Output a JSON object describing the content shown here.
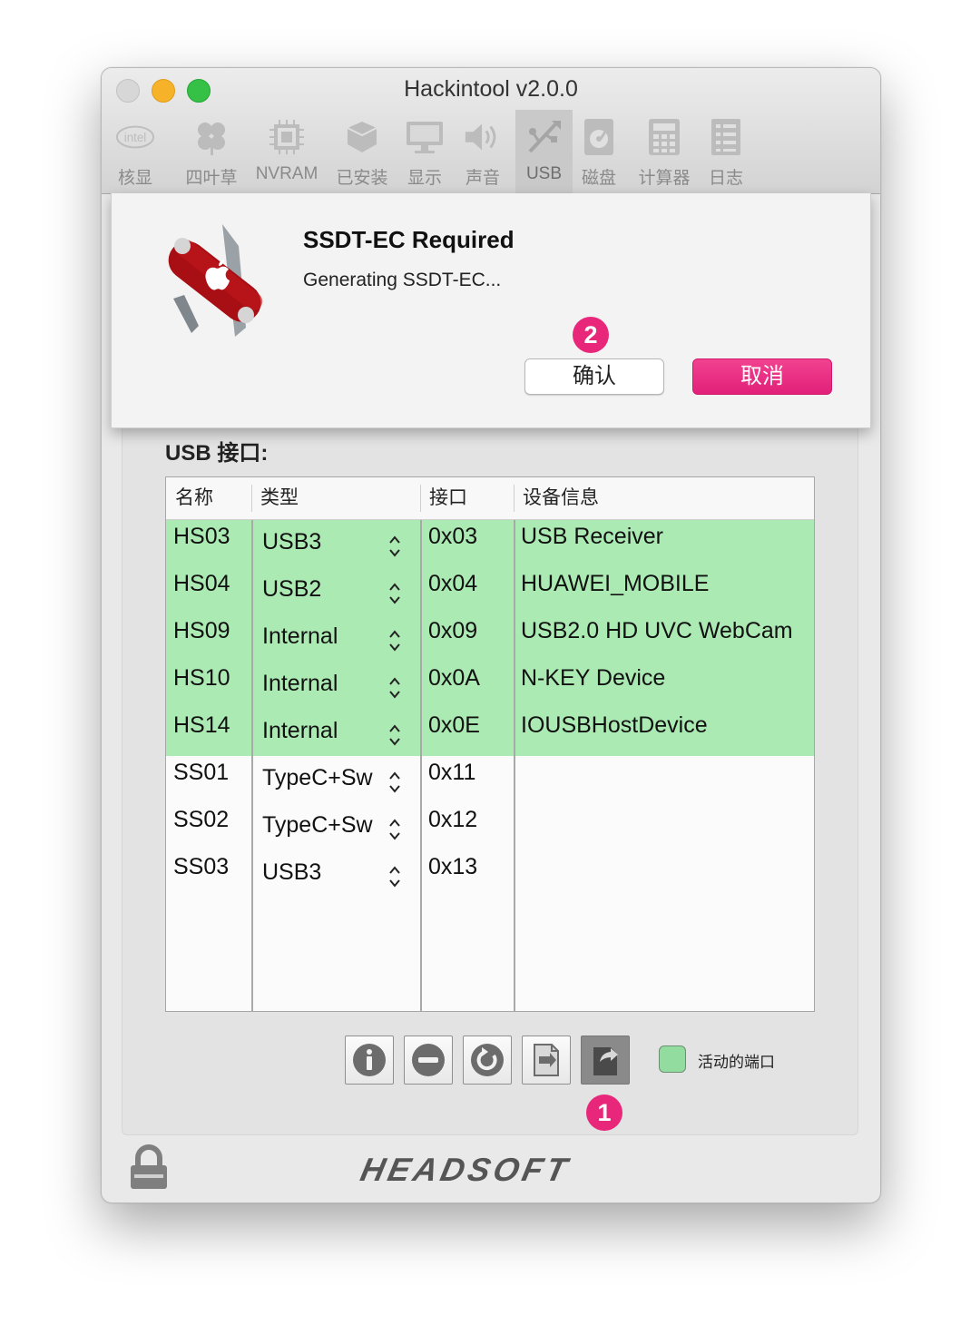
{
  "window": {
    "title": "Hackintool v2.0.0"
  },
  "toolbar": {
    "items": [
      {
        "label": "核显",
        "icon": "intel-icon"
      },
      {
        "label": "四叶草",
        "icon": "clover-icon"
      },
      {
        "label": "NVRAM",
        "icon": "chip-icon"
      },
      {
        "label": "已安装",
        "icon": "box-icon"
      },
      {
        "label": "显示",
        "icon": "monitor-icon"
      },
      {
        "label": "声音",
        "icon": "speaker-icon"
      },
      {
        "label": "USB",
        "icon": "usb-icon",
        "active": true
      },
      {
        "label": "磁盘",
        "icon": "disk-icon"
      },
      {
        "label": "计算器",
        "icon": "calculator-icon"
      },
      {
        "label": "日志",
        "icon": "log-icon"
      }
    ],
    "intel_logo_text": "intel"
  },
  "dialog": {
    "title": "SSDT-EC Required",
    "message": "Generating SSDT-EC...",
    "confirm_label": "确认",
    "cancel_label": "取消"
  },
  "usb": {
    "section_title": "USB 接口:",
    "columns": [
      "名称",
      "类型",
      "接口",
      "设备信息"
    ],
    "rows": [
      {
        "name": "HS03",
        "type": "USB3",
        "port": "0x03",
        "info": "USB Receiver",
        "active": true
      },
      {
        "name": "HS04",
        "type": "USB2",
        "port": "0x04",
        "info": "HUAWEI_MOBILE",
        "active": true
      },
      {
        "name": "HS09",
        "type": "Internal",
        "port": "0x09",
        "info": "USB2.0 HD UVC WebCam",
        "active": true
      },
      {
        "name": "HS10",
        "type": "Internal",
        "port": "0x0A",
        "info": "N-KEY Device",
        "active": true
      },
      {
        "name": "HS14",
        "type": "Internal",
        "port": "0x0E",
        "info": "IOUSBHostDevice",
        "active": true
      },
      {
        "name": "SS01",
        "type": "TypeC+Sw",
        "port": "0x11",
        "info": "",
        "active": false
      },
      {
        "name": "SS02",
        "type": "TypeC+Sw",
        "port": "0x12",
        "info": "",
        "active": false
      },
      {
        "name": "SS03",
        "type": "USB3",
        "port": "0x13",
        "info": "",
        "active": false
      }
    ],
    "legend_label": "活动的端口",
    "active_color": "#aceab3"
  },
  "markers": {
    "first": "1",
    "second": "2"
  },
  "footer": {
    "logo_text": "HEADSOFT"
  },
  "colors": {
    "accent": "#e8267a",
    "active_row": "#aceab3"
  }
}
